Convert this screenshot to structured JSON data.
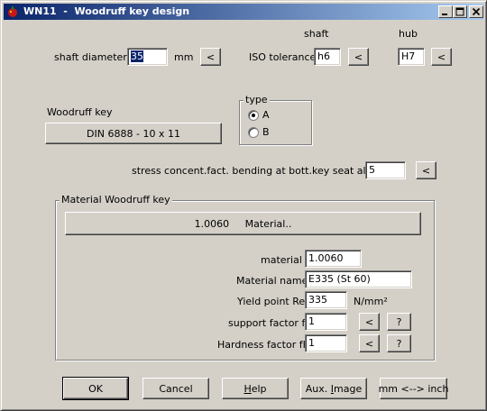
{
  "window": {
    "title": "WN11  -  Woodruff key design"
  },
  "shaft_diameter": {
    "label": "shaft diameter d",
    "value": "35",
    "unit": "mm",
    "button": "<"
  },
  "tolerance": {
    "label": "ISO tolerance",
    "shaft_header": "shaft",
    "hub_header": "hub",
    "shaft_value": "h6",
    "hub_value": "H7",
    "shaft_button": "<",
    "hub_button": "<"
  },
  "key": {
    "label": "Woodruff key",
    "button": "DIN 6888 - 10 x 11"
  },
  "type_group": {
    "legend": "type",
    "options": [
      "A",
      "B"
    ],
    "selected": "A"
  },
  "stress": {
    "label": "stress concent.fact. bending at bott.key seat alpha kb",
    "value": "5",
    "button": "<"
  },
  "material": {
    "legend": "Material Woodruff key",
    "material_button": "1.0060     Material..",
    "material_no_label": "material no.",
    "material_no": "1.0060",
    "material_name_label": "Material name",
    "material_name": "E335 (St 60)",
    "yield_label": "Yield point Re",
    "yield_value": "335",
    "yield_unit": "N/mm²",
    "support_label": "support factor fS",
    "support_value": "1",
    "hardness_label": "Hardness factor fH",
    "hardness_value": "1",
    "back_button": "<",
    "help_button": "?"
  },
  "footer": {
    "ok": "OK",
    "cancel": "Cancel",
    "help_pre": "",
    "help_u": "H",
    "help_post": "elp",
    "aux_pre": "Aux. ",
    "aux_u": "I",
    "aux_post": "mage",
    "units": "mm <--> inch"
  },
  "colors": {
    "titlebar_start": "#0a246a",
    "titlebar_end": "#a6caf0",
    "face": "#d4d0c8"
  },
  "icons": [
    "app-icon",
    "minimize-icon",
    "maximize-icon",
    "close-icon"
  ]
}
